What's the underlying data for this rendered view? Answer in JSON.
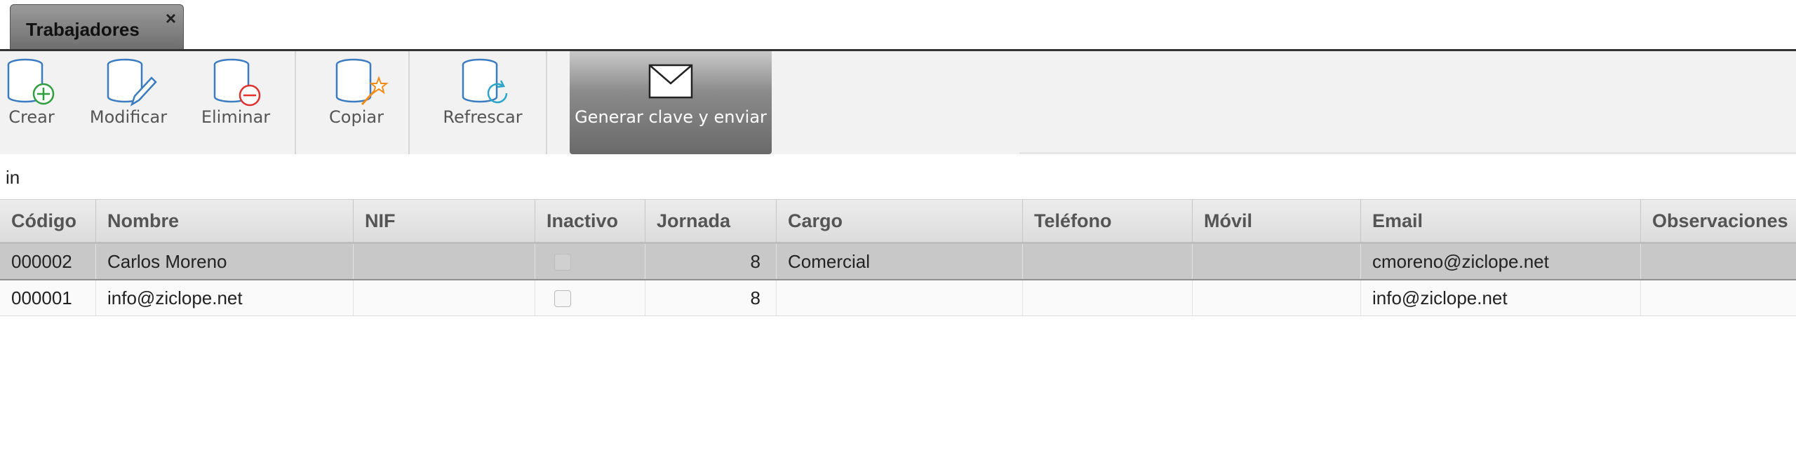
{
  "tab": {
    "title": "Trabajadores",
    "close": "×"
  },
  "toolbar": {
    "crear": "Crear",
    "modificar": "Modificar",
    "eliminar": "Eliminar",
    "copiar": "Copiar",
    "refrescar": "Refrescar",
    "generar": "Generar clave y enviar"
  },
  "filter_text": "in",
  "columns": [
    "Código",
    "Nombre",
    "NIF",
    "Inactivo",
    "Jornada",
    "Cargo",
    "Teléfono",
    "Móvil",
    "Email",
    "Observaciones"
  ],
  "rows": [
    {
      "codigo": "000002",
      "nombre": "Carlos Moreno",
      "nif": "",
      "inactivo": false,
      "jornada": "8",
      "cargo": "Comercial",
      "telefono": "",
      "movil": "",
      "email": "cmoreno@ziclope.net",
      "observaciones": ""
    },
    {
      "codigo": "000001",
      "nombre": "info@ziclope.net",
      "nif": "",
      "inactivo": false,
      "jornada": "8",
      "cargo": "",
      "telefono": "",
      "movil": "",
      "email": "info@ziclope.net",
      "observaciones": ""
    }
  ],
  "colors": {
    "icon_blue": "#3b7bbf",
    "add_green": "#2e9e3e",
    "delete_red": "#e03030",
    "wand_orange": "#f08c1a",
    "refresh_teal": "#2aa6c8"
  }
}
